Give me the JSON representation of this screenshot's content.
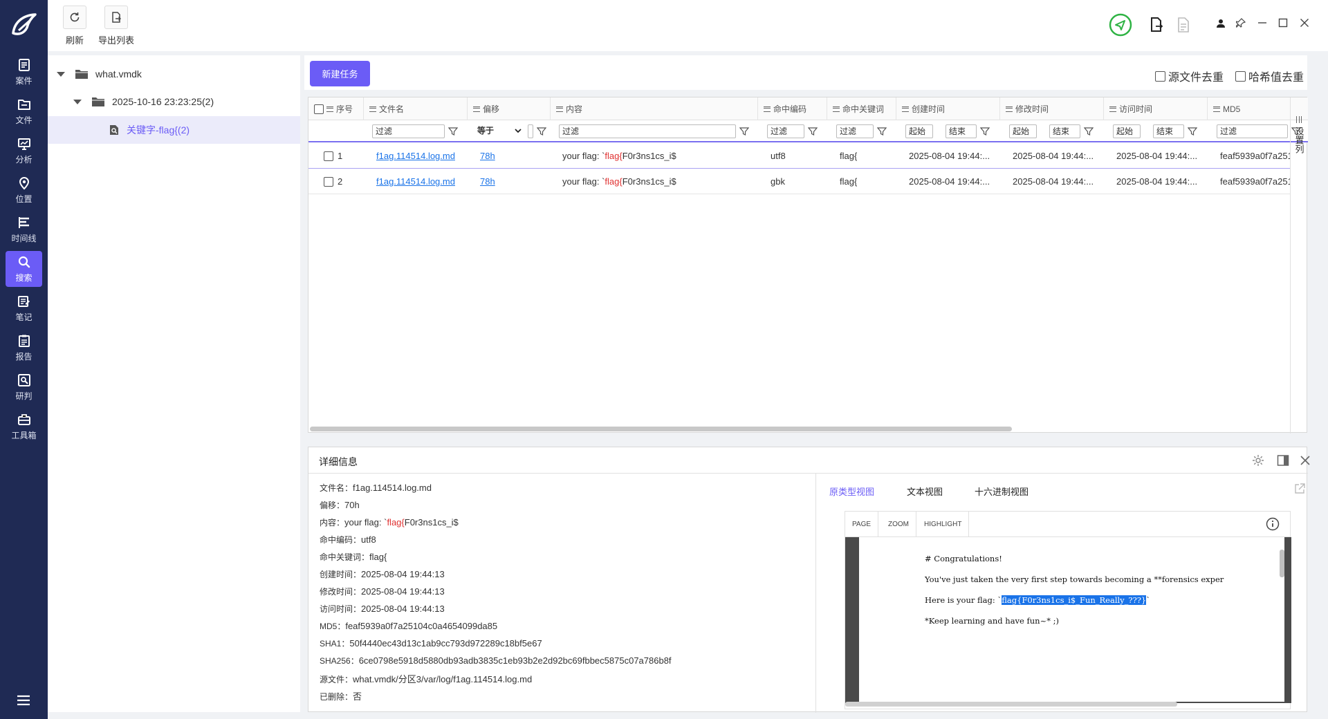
{
  "nav": {
    "items": [
      {
        "label": "案件",
        "icon": "case-icon"
      },
      {
        "label": "文件",
        "icon": "folder-icon"
      },
      {
        "label": "分析",
        "icon": "analysis-icon"
      },
      {
        "label": "位置",
        "icon": "location-icon"
      },
      {
        "label": "时间线",
        "icon": "timeline-icon"
      },
      {
        "label": "搜索",
        "icon": "search-icon"
      },
      {
        "label": "笔记",
        "icon": "note-icon"
      },
      {
        "label": "报告",
        "icon": "report-icon"
      },
      {
        "label": "研判",
        "icon": "judge-icon"
      },
      {
        "label": "工具箱",
        "icon": "toolbox-icon"
      }
    ],
    "active": "搜索"
  },
  "toolbar": {
    "refresh_label": "刷新",
    "export_label": "导出列表"
  },
  "tree": {
    "root": "what.vmdk",
    "child": "2025-10-16 23:23:25(2)",
    "leaf": "关键字-flag{(2)"
  },
  "main": {
    "new_task_label": "新建任务",
    "dedup_source_label": "源文件去重",
    "dedup_hash_label": "哈希值去重"
  },
  "table": {
    "columns": [
      "序号",
      "文件名",
      "偏移",
      "内容",
      "命中编码",
      "命中关键词",
      "创建时间",
      "修改时间",
      "访问时间",
      "MD5"
    ],
    "filter": {
      "placeholder": "过滤",
      "offset_op": "等于",
      "start": "起始",
      "end": "结束"
    },
    "rows": [
      {
        "index": "1",
        "filename": "f1ag.114514.log.md",
        "offset": "78h",
        "content_pre": "your flag: `",
        "content_hit": "flag{",
        "content_post": "F0r3ns1cs_i$",
        "encoding": "utf8",
        "keyword": "flag{",
        "created": "2025-08-04 19:44:...",
        "modified": "2025-08-04 19:44:...",
        "accessed": "2025-08-04 19:44:...",
        "md5": "feaf5939a0f7a251..."
      },
      {
        "index": "2",
        "filename": "f1ag.114514.log.md",
        "offset": "78h",
        "content_pre": "your flag: `",
        "content_hit": "flag{",
        "content_post": "F0r3ns1cs_i$",
        "encoding": "gbk",
        "keyword": "flag{",
        "created": "2025-08-04 19:44:...",
        "modified": "2025-08-04 19:44:...",
        "accessed": "2025-08-04 19:44:...",
        "md5": "feaf5939a0f7a251..."
      }
    ],
    "settings_label": "设置列"
  },
  "details": {
    "title": "详细信息",
    "fields": [
      {
        "k": "文件名：",
        "v": "f1ag.114514.log.md"
      },
      {
        "k": "偏移：",
        "v": "70h"
      },
      {
        "k": "内容：",
        "v_pre": "your flag: `",
        "v_hit": "flag{",
        "v_post": "F0r3ns1cs_i$"
      },
      {
        "k": "命中编码：",
        "v": "utf8"
      },
      {
        "k": "命中关键词：",
        "v": "flag{"
      },
      {
        "k": "创建时间：",
        "v": "2025-08-04 19:44:13"
      },
      {
        "k": "修改时间：",
        "v": "2025-08-04 19:44:13"
      },
      {
        "k": "访问时间：",
        "v": "2025-08-04 19:44:13"
      },
      {
        "k": "MD5：",
        "v": "feaf5939a0f7a25104c0a4654099da85"
      },
      {
        "k": "SHA1：",
        "v": "50f4440ec43d13c1ab9cc793d972289c18bf5e67"
      },
      {
        "k": "SHA256：",
        "v": "6ce0798e5918d5880db93adb3835c1eb93b2e2d92bc69fbbec5875c07a786b8f"
      },
      {
        "k": "源文件：",
        "v": "what.vmdk/分区3/var/log/f1ag.114514.log.md"
      },
      {
        "k": "已删除：",
        "v": "否"
      }
    ],
    "tabs": [
      "原类型视图",
      "文本视图",
      "十六进制视图"
    ],
    "viewer": {
      "buttons": [
        "PAGE",
        "ZOOM",
        "HIGHLIGHT"
      ],
      "lines": {
        "l1": "# Congratulations!",
        "l2": "You've just taken the very first step towards becoming a **forensics exper",
        "l3_pre": "Here is your flag: `",
        "l3_hit": "flag{F0r3ns1cs_i$_Fun_Really_???}",
        "l3_post": "`",
        "l4": "*Keep learning and have fun~* ;)"
      }
    }
  },
  "colors": {
    "accent": "#6b5cf6",
    "nav_bg": "#1f2a54",
    "link": "#1a73e8",
    "hit": "#e03131"
  }
}
